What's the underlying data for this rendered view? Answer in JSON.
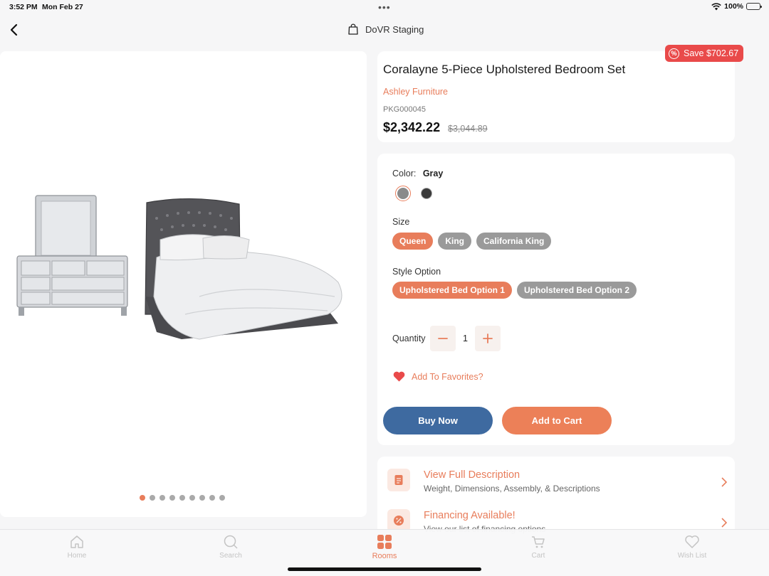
{
  "status_bar": {
    "time": "3:52 PM",
    "date": "Mon Feb 27",
    "dots": "•••",
    "battery": "100%"
  },
  "header": {
    "store_name": "DoVR Staging",
    "back_icon": "chevron-left-icon",
    "store_icon": "shopping-bag-icon"
  },
  "gallery": {
    "image_count": 9,
    "active_index": 0
  },
  "product": {
    "save_badge": "Save $702.67",
    "title": "Coralayne 5-Piece Upholstered Bedroom Set",
    "brand": "Ashley Furniture",
    "sku": "PKG000045",
    "price": "$2,342.22",
    "original_price": "$3,044.89"
  },
  "options": {
    "color_label": "Color:",
    "color_value": "Gray",
    "colors": [
      {
        "name": "Gray",
        "hex": "#8a8a8a",
        "selected": true
      },
      {
        "name": "Black",
        "hex": "#3a3a3a",
        "selected": false
      }
    ],
    "size_label": "Size",
    "sizes": [
      {
        "label": "Queen",
        "active": true
      },
      {
        "label": "King",
        "active": false
      },
      {
        "label": "California King",
        "active": false
      }
    ],
    "style_label": "Style Option",
    "styles": [
      {
        "label": "Upholstered Bed Option 1",
        "active": true
      },
      {
        "label": "Upholstered Bed Option 2",
        "active": false
      }
    ],
    "quantity_label": "Quantity",
    "quantity_value": "1",
    "favorites_label": "Add To Favorites?",
    "buy_now_label": "Buy Now",
    "add_to_cart_label": "Add to Cart"
  },
  "links": [
    {
      "title": "View Full Description",
      "subtitle": "Weight, Dimensions, Assembly, & Descriptions",
      "icon": "document-icon"
    },
    {
      "title": "Financing Available!",
      "subtitle": "View our list of financing options",
      "icon": "percent-badge-icon"
    }
  ],
  "bottom_nav": [
    {
      "label": "Home",
      "icon": "home-icon",
      "active": false
    },
    {
      "label": "Search",
      "icon": "search-icon",
      "active": false
    },
    {
      "label": "Rooms",
      "icon": "rooms-grid-icon",
      "active": true
    },
    {
      "label": "Cart",
      "icon": "cart-icon",
      "active": false
    },
    {
      "label": "Wish List",
      "icon": "heart-icon",
      "active": false
    }
  ],
  "colors": {
    "accent": "#e87d5b",
    "buy_button": "#3e6aa0",
    "save_badge": "#e94a4a"
  }
}
